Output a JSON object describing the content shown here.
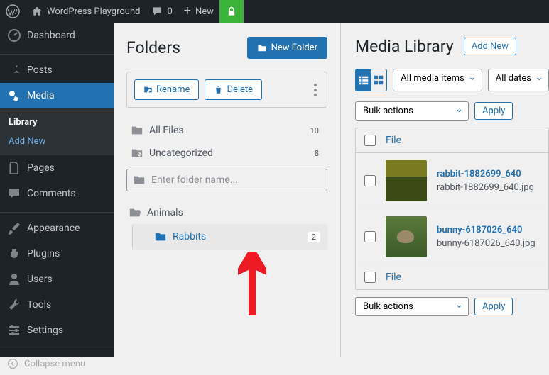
{
  "adminbar": {
    "site_title": "WordPress Playground",
    "comments_count": "0",
    "new_label": "New"
  },
  "sidebar": {
    "dashboard": "Dashboard",
    "posts": "Posts",
    "media": "Media",
    "media_sub": {
      "library": "Library",
      "add_new": "Add New"
    },
    "pages": "Pages",
    "comments": "Comments",
    "appearance": "Appearance",
    "plugins": "Plugins",
    "users": "Users",
    "tools": "Tools",
    "settings": "Settings",
    "collapse": "Collapse menu"
  },
  "folders": {
    "title": "Folders",
    "new_folder": "New Folder",
    "rename": "Rename",
    "delete": "Delete",
    "all_files": {
      "label": "All Files",
      "count": "10"
    },
    "uncategorized": {
      "label": "Uncategorized",
      "count": "8"
    },
    "search_placeholder": "Enter folder name...",
    "tree": {
      "parent": "Animals",
      "child": {
        "label": "Rabbits",
        "count": "2"
      }
    }
  },
  "media": {
    "title": "Media Library",
    "add_new": "Add New",
    "filter_media": "All media items",
    "filter_dates": "All dates",
    "bulk_actions": "Bulk actions",
    "apply": "Apply",
    "file_col": "File",
    "rows": [
      {
        "title": "rabbit-1882699_640",
        "file": "rabbit-1882699_640.jpg"
      },
      {
        "title": "bunny-6187026_640",
        "file": "bunny-6187026_640.jpg"
      }
    ]
  }
}
